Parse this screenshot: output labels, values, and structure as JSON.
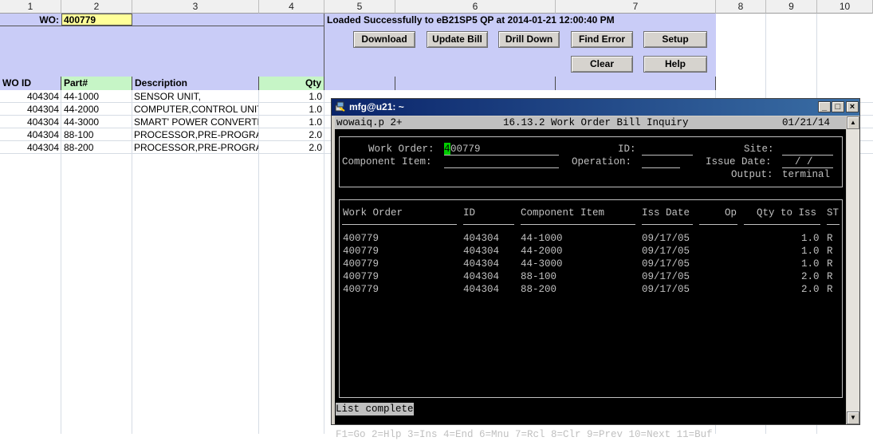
{
  "sheet": {
    "col_headers": [
      "1",
      "2",
      "3",
      "4",
      "5",
      "6",
      "7",
      "8",
      "9",
      "10"
    ],
    "wo_label": "WO:",
    "wo_value": "400779",
    "status": "Loaded Successfully to eB21SP5 QP at 2014-01-21 12:00:40 PM",
    "buttons": {
      "download": "Download",
      "update_bill": "Update Bill",
      "drill_down": "Drill Down",
      "find_error": "Find Error",
      "setup": "Setup",
      "clear": "Clear",
      "help": "Help"
    },
    "table_headers": {
      "wo_id": "WO ID",
      "part": "Part#",
      "description": "Description",
      "qty": "Qty"
    },
    "rows": [
      {
        "wo_id": "404304",
        "part": "44-1000",
        "description": "SENSOR UNIT,",
        "qty": "1.0"
      },
      {
        "wo_id": "404304",
        "part": "44-2000",
        "description": "COMPUTER,CONTROL UNIT",
        "qty": "1.0"
      },
      {
        "wo_id": "404304",
        "part": "44-3000",
        "description": "SMART' POWER CONVERTER",
        "qty": "1.0"
      },
      {
        "wo_id": "404304",
        "part": "88-100",
        "description": "PROCESSOR,PRE-PROGRAMMED",
        "qty": "2.0"
      },
      {
        "wo_id": "404304",
        "part": "88-200",
        "description": "PROCESSOR,PRE-PROGRAMMED",
        "qty": "2.0"
      }
    ]
  },
  "terminal": {
    "title": "mfg@u21: ~",
    "program": "wowaiq.p 2+",
    "screen_title": "16.13.2 Work Order Bill Inquiry",
    "date": "01/21/14",
    "form": {
      "work_order_label": "Work Order:",
      "work_order_cursor": "4",
      "work_order_value": "00779",
      "id_label": "ID:",
      "site_label": "Site:",
      "component_label": "Component Item:",
      "operation_label": "Operation:",
      "issue_date_label": "Issue Date:",
      "issue_date_value": "/ /",
      "output_label": "Output:",
      "output_value": "terminal"
    },
    "columns": [
      "Work Order",
      "ID",
      "Component Item",
      "Iss Date",
      "Op",
      "Qty to Iss",
      "ST"
    ],
    "rows": [
      {
        "wo": "400779",
        "id": "404304",
        "item": "44-1000",
        "date": "09/17/05",
        "qty": "1.0",
        "st": "R"
      },
      {
        "wo": "400779",
        "id": "404304",
        "item": "44-2000",
        "date": "09/17/05",
        "qty": "1.0",
        "st": "R"
      },
      {
        "wo": "400779",
        "id": "404304",
        "item": "44-3000",
        "date": "09/17/05",
        "qty": "1.0",
        "st": "R"
      },
      {
        "wo": "400779",
        "id": "404304",
        "item": "88-100",
        "date": "09/17/05",
        "qty": "2.0",
        "st": "R"
      },
      {
        "wo": "400779",
        "id": "404304",
        "item": "88-200",
        "date": "09/17/05",
        "qty": "2.0",
        "st": "R"
      }
    ],
    "status_message": "List complete",
    "function_keys": "F1=Go 2=Hlp 3=Ins 4=End 6=Mnu 7=Rcl 8=Clr 9=Prev 10=Next 11=Buf"
  }
}
